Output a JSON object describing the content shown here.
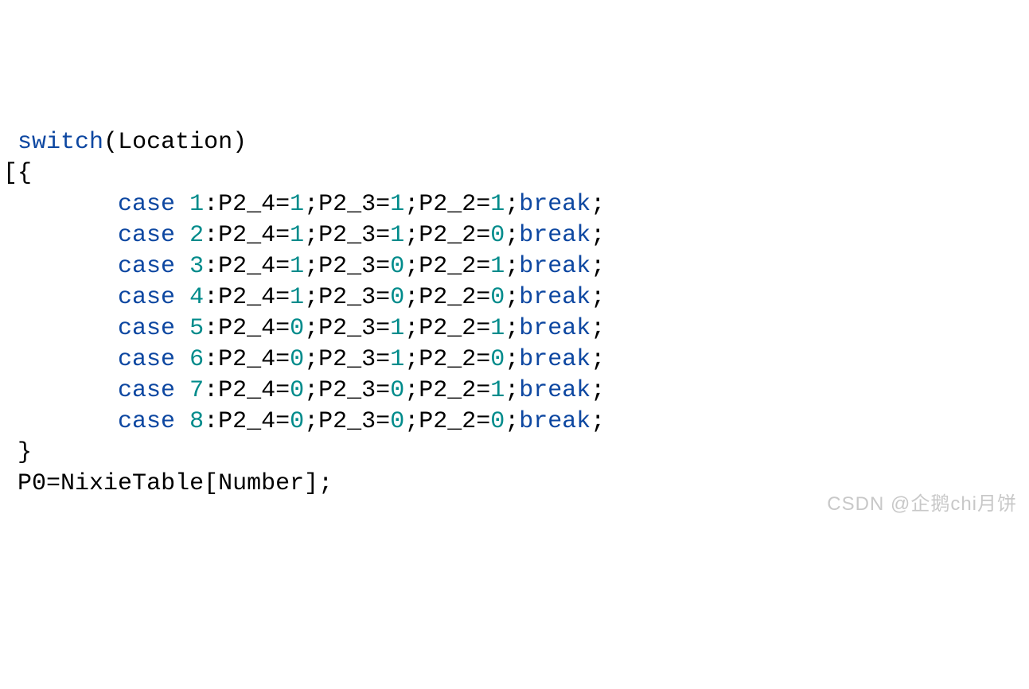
{
  "code": {
    "kw_switch": "switch",
    "lparen": "(",
    "var_location": "Location",
    "rparen": ")",
    "bracket_open": "[",
    "brace_open": "{",
    "brace_close": "}",
    "indent": "        ",
    "kw_case": "case",
    "kw_break": "break",
    "p2_4": "P2_4",
    "p2_3": "P2_3",
    "p2_2": "P2_2",
    "eq": "=",
    "semi": ";",
    "colon": ":",
    "zero": "0",
    "one": "1",
    "cases": [
      {
        "n": "1",
        "v4": "1",
        "v3": "1",
        "v2": "1"
      },
      {
        "n": "2",
        "v4": "1",
        "v3": "1",
        "v2": "0"
      },
      {
        "n": "3",
        "v4": "1",
        "v3": "0",
        "v2": "1"
      },
      {
        "n": "4",
        "v4": "1",
        "v3": "0",
        "v2": "0"
      },
      {
        "n": "5",
        "v4": "0",
        "v3": "1",
        "v2": "1"
      },
      {
        "n": "6",
        "v4": "0",
        "v3": "1",
        "v2": "0"
      },
      {
        "n": "7",
        "v4": "0",
        "v3": "0",
        "v2": "1"
      },
      {
        "n": "8",
        "v4": "0",
        "v3": "0",
        "v2": "0"
      }
    ],
    "last_line_p0": "P0",
    "last_line_nixie": "NixieTable",
    "last_line_lbracket": "[",
    "last_line_number": "Number",
    "last_line_rbracket": "]"
  },
  "watermark": "CSDN @企鹅chi月饼"
}
